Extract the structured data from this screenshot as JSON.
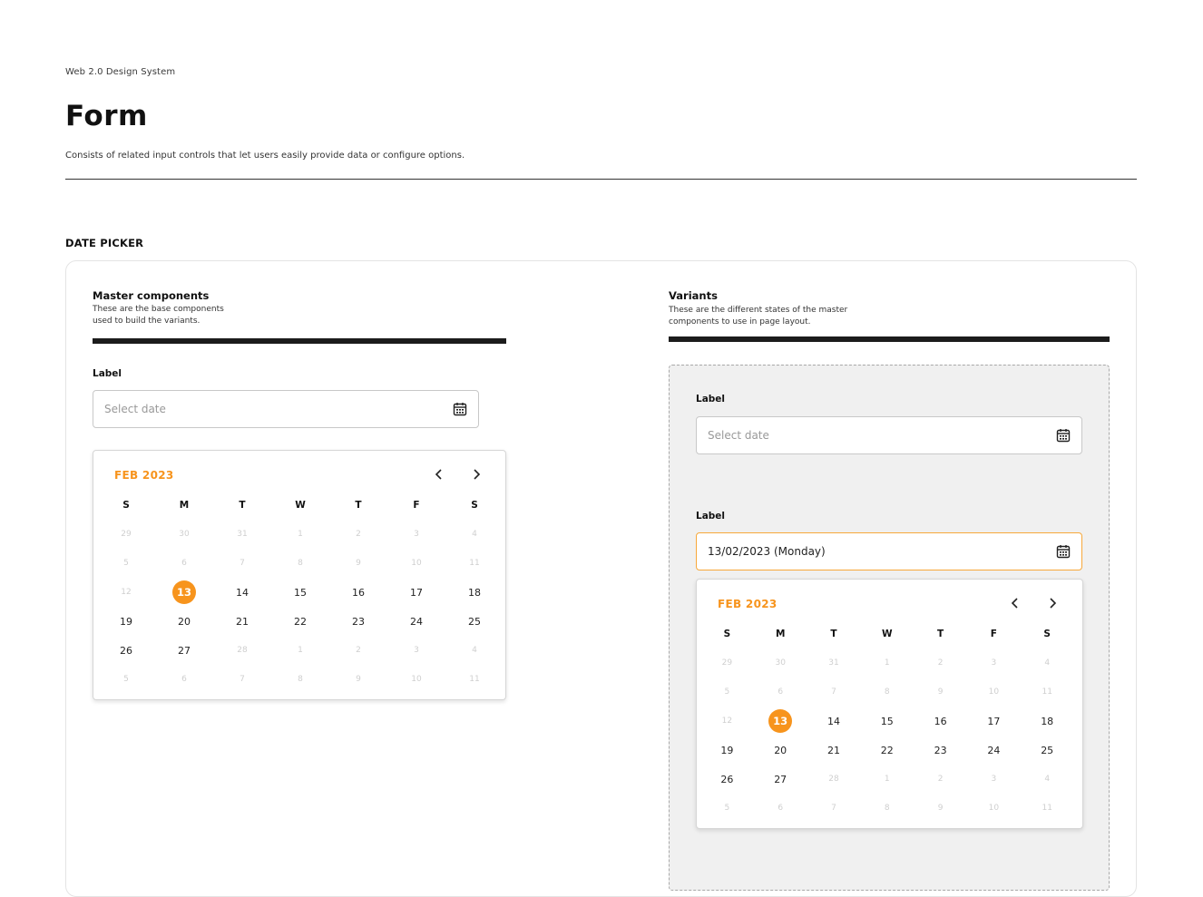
{
  "header": {
    "eyebrow": "Web 2.0 Design System",
    "title": "Form",
    "description": "Consists of related input controls that let users easily provide data or configure options."
  },
  "section": {
    "label": "DATE PICKER"
  },
  "master": {
    "heading": "Master components",
    "sub_line1": "These are the base components",
    "sub_line2": "used to build the variants.",
    "field_label": "Label",
    "placeholder": "Select date"
  },
  "variants": {
    "heading": "Variants",
    "sub_line1": "These are the different states of the master",
    "sub_line2": "components to use in page layout.",
    "field1_label": "Label",
    "field1_placeholder": "Select date",
    "field2_label": "Label",
    "field2_value": "13/02/2023 (Monday)"
  },
  "calendar": {
    "month_label": "FEB 2023",
    "prev_icon": "chevron-left-icon",
    "next_icon": "chevron-right-icon",
    "weekdays": [
      "S",
      "M",
      "T",
      "W",
      "T",
      "F",
      "S"
    ],
    "weeks": [
      [
        "29",
        "30",
        "31",
        "1",
        "2",
        "3",
        "4"
      ],
      [
        "5",
        "6",
        "7",
        "8",
        "9",
        "10",
        "11"
      ],
      [
        "12",
        "13",
        "14",
        "15",
        "16",
        "17",
        "18"
      ],
      [
        "19",
        "20",
        "21",
        "22",
        "23",
        "24",
        "25"
      ],
      [
        "26",
        "27",
        "28",
        "1",
        "2",
        "3",
        "4"
      ],
      [
        "5",
        "6",
        "7",
        "8",
        "9",
        "10",
        "11"
      ]
    ],
    "muted": [
      [
        true,
        true,
        true,
        true,
        true,
        true,
        true
      ],
      [
        true,
        true,
        true,
        true,
        true,
        true,
        true
      ],
      [
        true,
        false,
        false,
        false,
        false,
        false,
        false
      ],
      [
        false,
        false,
        false,
        false,
        false,
        false,
        false
      ],
      [
        false,
        false,
        true,
        true,
        true,
        true,
        true
      ],
      [
        true,
        true,
        true,
        true,
        true,
        true,
        true
      ]
    ],
    "selected_day": "13",
    "accent_color": "#f7941d"
  },
  "icons": {
    "calendar": "calendar-icon"
  },
  "colors": {
    "accent": "#f7941d",
    "focus_border": "#f7a83a",
    "bar": "#1c1c1c"
  }
}
